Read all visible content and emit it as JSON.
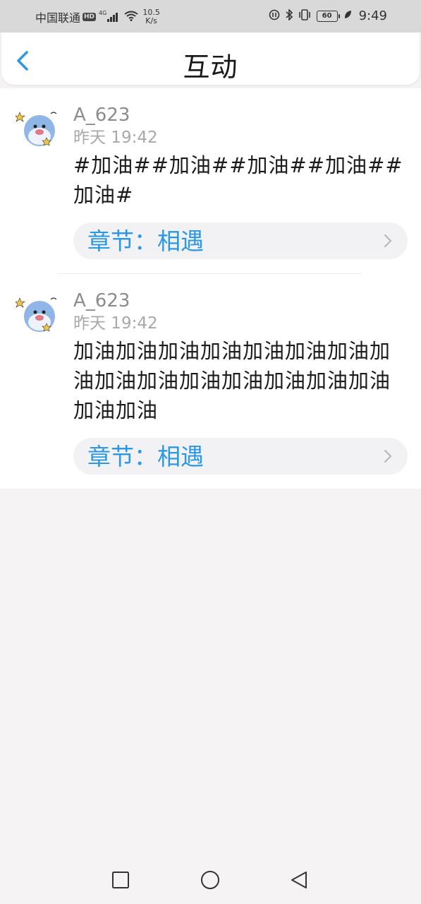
{
  "status_bar": {
    "carrier": "中国联通",
    "hd": "HD",
    "network": "4G",
    "speed_value": "10.5",
    "speed_unit": "K/s",
    "battery": "60",
    "time": "9:49"
  },
  "header": {
    "title": "互动"
  },
  "posts": [
    {
      "username": "A_623",
      "time": "昨天 19:42",
      "content": "#加油##加油##加油##加油##加油#",
      "chapter": "章节：相遇"
    },
    {
      "username": "A_623",
      "time": "昨天 19:42",
      "content": "加油加油加油加油加油加油加油加油加油加油加油加油加油加油加油加油加油",
      "chapter": "章节：相遇"
    }
  ],
  "colors": {
    "accent": "#2b98e6",
    "status_bar_bg": "#d9d9d9",
    "page_bg": "#f5f3f4"
  },
  "icons": {
    "back": "chevron-left-icon",
    "chapter_arrow": "chevron-right-icon",
    "nav_recent": "square-icon",
    "nav_home": "circle-icon",
    "nav_back": "triangle-back-icon"
  }
}
